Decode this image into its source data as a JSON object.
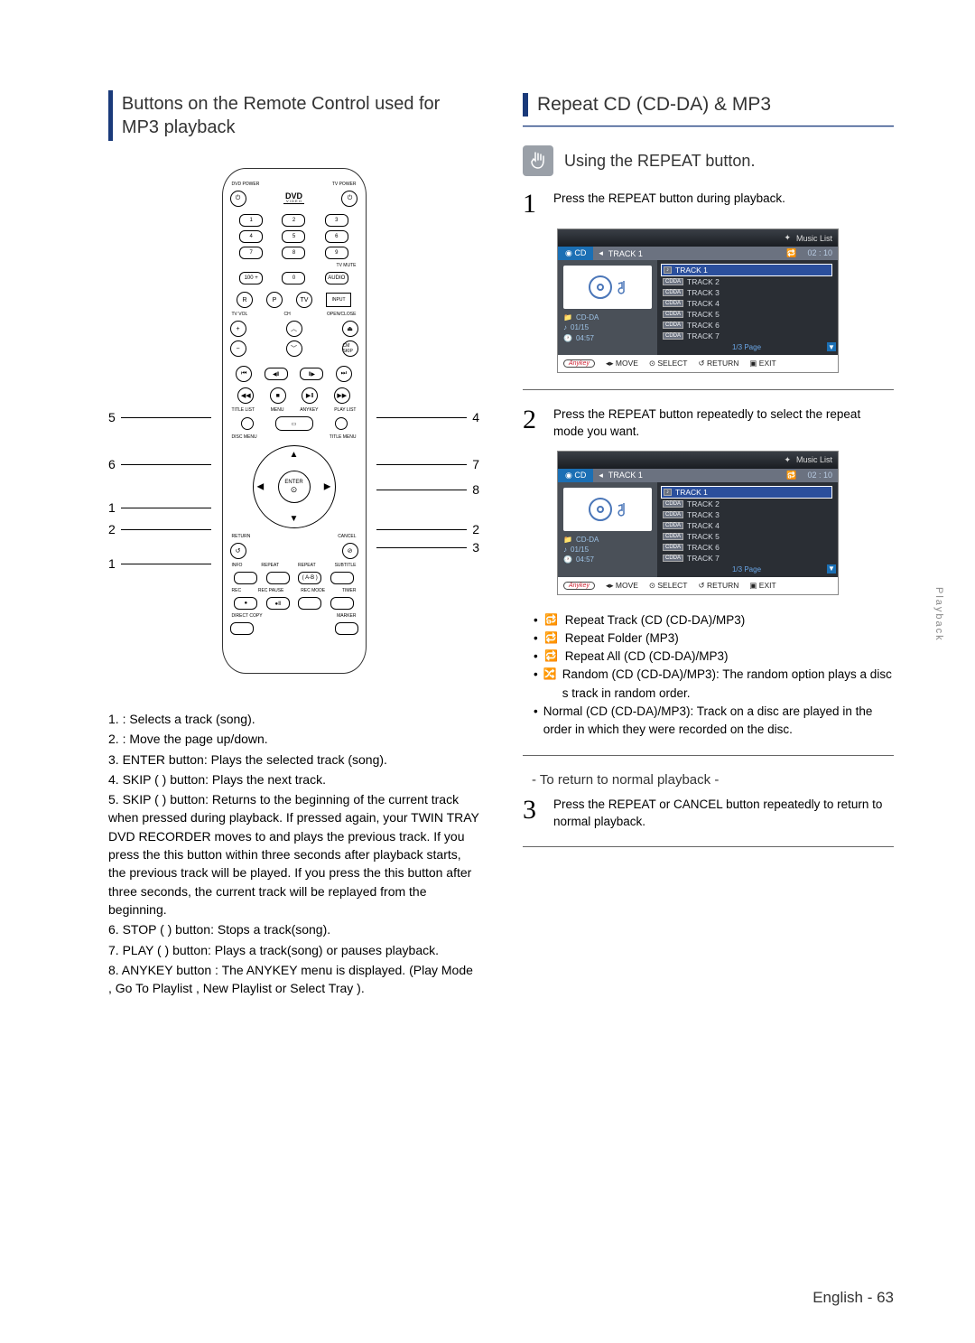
{
  "left": {
    "heading": "Buttons on the Remote Control used for MP3 playback",
    "remote": {
      "labels": {
        "dvd_power": "DVD POWER",
        "tv_power": "TV POWER",
        "tv_mute": "TV MUTE",
        "audio": "AUDIO",
        "r": "R",
        "p": "P",
        "tv": "TV",
        "input": "INPUT",
        "tv_vol": "TV VOL",
        "ch": "CH",
        "open_close": "OPEN/CLOSE",
        "cm_skip": "CM SKIP",
        "title_list": "TITLE LIST",
        "menu": "MENU",
        "anykey": "ANYKEY",
        "play_list": "PLAY LIST",
        "disc_menu": "DISC MENU",
        "title_menu": "TITLE MENU",
        "enter": "ENTER",
        "return": "RETURN",
        "cancel": "CANCEL",
        "info": "INFO",
        "repeat": "REPEAT",
        "repeat_ab": "REPEAT",
        "ab": "( A-B )",
        "subtitle": "SUBTITLE",
        "rec": "REC",
        "rec_pause": "REC PAUSE",
        "rec_mode": "REC MODE",
        "timer": "TIMER",
        "direct_copy": "DIRECT COPY",
        "marker": "MARKER",
        "hundred": "100 +",
        "zero": "0",
        "numbers": [
          "1",
          "2",
          "3",
          "4",
          "5",
          "6",
          "7",
          "8",
          "9"
        ]
      }
    },
    "callouts_left": [
      "5",
      "6",
      "1",
      "2",
      "1"
    ],
    "callouts_right": [
      "4",
      "7",
      "8",
      "2",
      "3"
    ],
    "legend": [
      "1.         : Selects a track (song).",
      "2.         : Move the page up/down.",
      "3. ENTER button:  Plays the selected track (song).",
      "4. SKIP (      ) button:  Plays the next track.",
      "5. SKIP (      ) button:  Returns to the beginning of the current track when pressed during playback. If pressed again, your TWIN TRAY DVD RECORDER moves to and plays the previous track. If you press the this button within three seconds after playback starts, the previous track will be played. If you press the this button after three seconds, the current track will be replayed from the beginning.",
      "6. STOP (     ) button:  Stops a track(song).",
      "7. PLAY  (     ) button:  Plays a track(song) or pauses playback.",
      "8. ANYKEY button  : The ANYKEY menu is displayed. (Play Mode , Go To Playlist  , New Playlist  or Select Tray )."
    ]
  },
  "right": {
    "heading": "Repeat CD (CD-DA) & MP3",
    "using": "Using the REPEAT button.",
    "step1": "Press the REPEAT button during playback.",
    "step2": "Press the REPEAT button repeatedly to select the repeat mode you want.",
    "osd": {
      "title": "Music List",
      "cd_label": "CD",
      "track_header": "TRACK  1",
      "time1": "02 : 10",
      "time2": "02 : 10",
      "left_info": {
        "type": "CD-DA",
        "track": "01/15",
        "elapsed": "04:57"
      },
      "tracks": [
        "TRACK 1",
        "TRACK 2",
        "TRACK 3",
        "TRACK 4",
        "TRACK 5",
        "TRACK 6",
        "TRACK 7"
      ],
      "page": "1/3 Page",
      "footer": {
        "anykey": "Anykey",
        "move": "MOVE",
        "select": "SELECT",
        "return": "RETURN",
        "exit": "EXIT"
      }
    },
    "repeat_items": [
      "Repeat Track (CD (CD-DA)/MP3)",
      "Repeat Folder (MP3)",
      "Repeat All (CD (CD-DA)/MP3)",
      "Random (CD (CD-DA)/MP3):  The random option plays a disc s track in random order.",
      "Normal (CD (CD-DA)/MP3):  Track on a disc are played in the order in which they were recorded on the disc."
    ],
    "sub_heading": "- To return to normal playback -",
    "step3": "Press the REPEAT or CANCEL button repeatedly to return to normal playback."
  },
  "footer": "English - 63",
  "side_tab": "Playback"
}
